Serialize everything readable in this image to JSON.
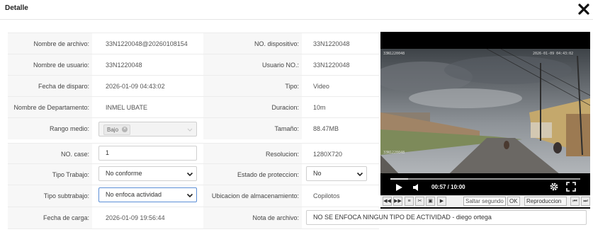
{
  "modal": {
    "title": "Detalle"
  },
  "fields": {
    "file_name": {
      "label": "Nombre de archivo:",
      "value": "33N1220048@20260108154"
    },
    "device_no": {
      "label": "NO. dispositivo:",
      "value": "33N1220048"
    },
    "user_name": {
      "label": "Nombre de usuario:",
      "value": "33N1220048"
    },
    "user_no": {
      "label": "Usuario NO.:",
      "value": "33N1220048"
    },
    "trigger_date": {
      "label": "Fecha de disparo:",
      "value": "2026-01-09 04:43:02"
    },
    "type": {
      "label": "Tipo:",
      "value": "Video"
    },
    "department": {
      "label": "Nombre de Departamento:",
      "value": "INMEL UBATE"
    },
    "duration": {
      "label": "Duracion:",
      "value": "10m"
    },
    "medium_range": {
      "label": "Rango medio:",
      "tag": "Bajo"
    },
    "size": {
      "label": "Tamaño:",
      "value": "88.47MB"
    },
    "case_no": {
      "label": "NO. case:",
      "value": "1"
    },
    "resolution": {
      "label": "Resolucion:",
      "value": "1280X720"
    },
    "work_type": {
      "label": "Tipo Trabajo:",
      "value": "No conforme"
    },
    "protection_state": {
      "label": "Estado de proteccion:",
      "value": "No"
    },
    "subwork_type": {
      "label": "Tipo subtrabajo:",
      "value": "No enfoca actividad"
    },
    "storage_location": {
      "label": "Ubicacion de almacenamiento:",
      "value": "Copilotos"
    },
    "upload_date": {
      "label": "Fecha de carga:",
      "value": "2026-01-09 19:56:44"
    },
    "file_note": {
      "label": "Nota de archivo:",
      "value": "NO SE ENFOCA NINGUN TIPO DE ACTIVIDAD  - diego ortega"
    }
  },
  "player": {
    "time": "00:57 / 10:00",
    "progress": 0.095,
    "overlay_top_left": "33N1220048",
    "overlay_top_right": "2026-01-09 04:43:02",
    "overlay_bottom_left": "33N1220048"
  },
  "toolbar": {
    "skip_placeholder": "Saltar segundo",
    "ok_label": "OK",
    "play_label": "Reproduccion"
  }
}
